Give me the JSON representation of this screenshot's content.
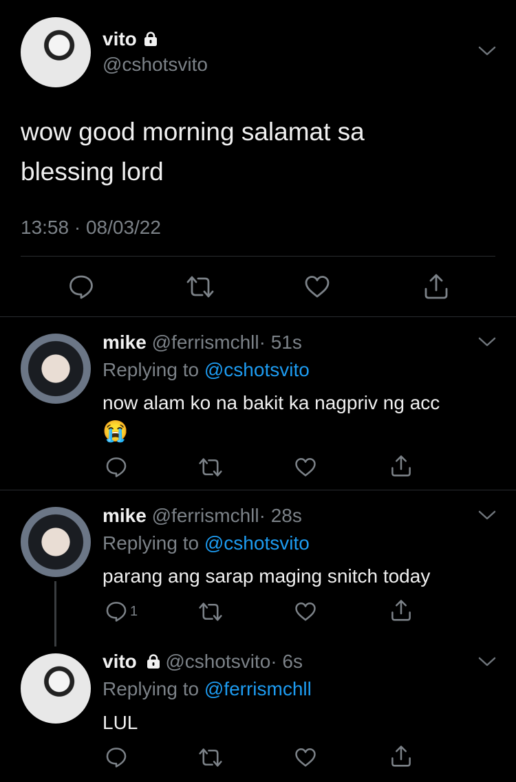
{
  "main_tweet": {
    "author_name": "vito",
    "author_handle": "@cshotsvito",
    "text_line1": "wow good morning salamat sa",
    "text_line2": "blessing lord",
    "timestamp": "13:58 · 08/03/22"
  },
  "replies": [
    {
      "name": "mike",
      "handle": "@ferrismchll",
      "age": "· 51s",
      "replying_prefix": "Replying to",
      "replying_to": "@cshotsvito",
      "text_line1": "now alam ko na bakit ka nagpriv ng acc",
      "emoji": "😭",
      "reply_count": ""
    },
    {
      "name": "mike",
      "handle": "@ferrismchll",
      "age": "· 28s",
      "replying_prefix": "Replying to",
      "replying_to": "@cshotsvito",
      "text_line1": "parang ang sarap maging snitch today",
      "reply_count": "1"
    },
    {
      "name": "vito",
      "handle": "@cshotsvito",
      "age": "· 6s",
      "replying_prefix": "Replying to",
      "replying_to": "@ferrismchll",
      "text_line1": "LUL",
      "reply_count": ""
    }
  ],
  "icons": {
    "reply": "reply-icon",
    "retweet": "retweet-icon",
    "like": "heart-icon",
    "share": "share-icon",
    "more": "chevron-down-icon",
    "lock": "lock-icon"
  },
  "colors": {
    "background": "#000000",
    "link": "#1d9bf0",
    "muted": "#7c8288",
    "divider": "#2a2d30"
  }
}
